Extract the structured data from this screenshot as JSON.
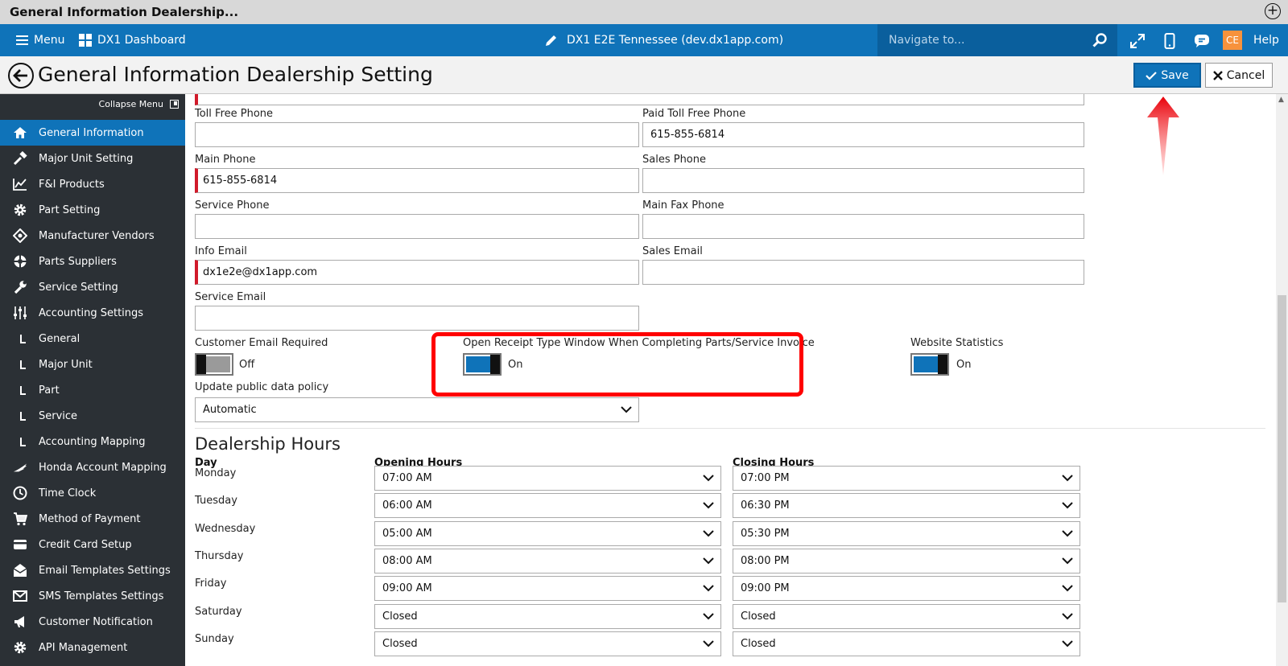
{
  "window": {
    "title": "General Information Dealership..."
  },
  "topbar": {
    "menu_label": "Menu",
    "dashboard_label": "DX1 Dashboard",
    "site_label": "DX1 E2E Tennessee (dev.dx1app.com)",
    "navigate_placeholder": "Navigate to...",
    "avatar_initials": "CE",
    "help_label": "Help"
  },
  "header": {
    "title": "General Information Dealership Setting",
    "save_label": "Save",
    "cancel_label": "Cancel"
  },
  "sidebar": {
    "collapse_label": "Collapse Menu",
    "items": [
      {
        "label": "General Information",
        "icon": "home-icon",
        "active": true
      },
      {
        "label": "Major Unit Setting",
        "icon": "hammer-icon"
      },
      {
        "label": "F&I Products",
        "icon": "chart-line-icon"
      },
      {
        "label": "Part Setting",
        "icon": "gear-icon"
      },
      {
        "label": "Manufacturer Vendors",
        "icon": "network-icon"
      },
      {
        "label": "Parts Suppliers",
        "icon": "lifebuoy-icon"
      },
      {
        "label": "Service Setting",
        "icon": "wrench-icon"
      },
      {
        "label": "Accounting Settings",
        "icon": "sliders-icon"
      },
      {
        "label": "General",
        "icon": "sub-item-icon"
      },
      {
        "label": "Major Unit",
        "icon": "sub-item-icon"
      },
      {
        "label": "Part",
        "icon": "sub-item-icon"
      },
      {
        "label": "Service",
        "icon": "sub-item-icon"
      },
      {
        "label": "Accounting Mapping",
        "icon": "sub-item-icon"
      },
      {
        "label": "Honda Account Mapping",
        "icon": "honda-wing-icon"
      },
      {
        "label": "Time Clock",
        "icon": "clock-icon"
      },
      {
        "label": "Method of Payment",
        "icon": "cart-icon"
      },
      {
        "label": "Credit Card Setup",
        "icon": "credit-card-icon"
      },
      {
        "label": "Email Templates Settings",
        "icon": "email-open-icon"
      },
      {
        "label": "SMS Templates Settings",
        "icon": "envelope-icon"
      },
      {
        "label": "Customer Notification",
        "icon": "megaphone-icon"
      },
      {
        "label": "API Management",
        "icon": "gear-icon"
      }
    ]
  },
  "form": {
    "toll_free_phone": {
      "label": "Toll Free Phone",
      "value": ""
    },
    "paid_toll_free_phone": {
      "label": "Paid Toll Free Phone",
      "value": "615-855-6814"
    },
    "main_phone": {
      "label": "Main Phone",
      "value": "615-855-6814"
    },
    "sales_phone": {
      "label": "Sales Phone",
      "value": ""
    },
    "service_phone": {
      "label": "Service Phone",
      "value": ""
    },
    "main_fax_phone": {
      "label": "Main Fax Phone",
      "value": ""
    },
    "info_email": {
      "label": "Info Email",
      "value": "dx1e2e@dx1app.com"
    },
    "sales_email": {
      "label": "Sales Email",
      "value": ""
    },
    "service_email": {
      "label": "Service Email",
      "value": ""
    },
    "customer_email_required": {
      "label": "Customer Email Required",
      "state": "Off"
    },
    "open_receipt_window": {
      "label": "Open Receipt Type Window When Completing Parts/Service Invoice",
      "state": "On"
    },
    "website_statistics": {
      "label": "Website Statistics",
      "state": "On"
    },
    "update_public_data_policy": {
      "label": "Update public data policy",
      "value": "Automatic"
    }
  },
  "hours": {
    "title": "Dealership Hours",
    "col_day": "Day",
    "col_opening": "Opening Hours",
    "col_closing": "Closing Hours",
    "days": [
      {
        "day": "Monday",
        "open": "07:00 AM",
        "close": "07:00 PM"
      },
      {
        "day": "Tuesday",
        "open": "06:00 AM",
        "close": "06:30 PM"
      },
      {
        "day": "Wednesday",
        "open": "05:00 AM",
        "close": "05:30 PM"
      },
      {
        "day": "Thursday",
        "open": "08:00 AM",
        "close": "08:00 PM"
      },
      {
        "day": "Friday",
        "open": "09:00 AM",
        "close": "09:00 PM"
      },
      {
        "day": "Saturday",
        "open": "Closed",
        "close": "Closed"
      },
      {
        "day": "Sunday",
        "open": "Closed",
        "close": "Closed"
      }
    ]
  },
  "colors": {
    "brand_blue": "#0f73b9",
    "sidebar_bg": "#2b3035",
    "required_red": "#d11a2a",
    "annotation_red": "#ff0000"
  }
}
